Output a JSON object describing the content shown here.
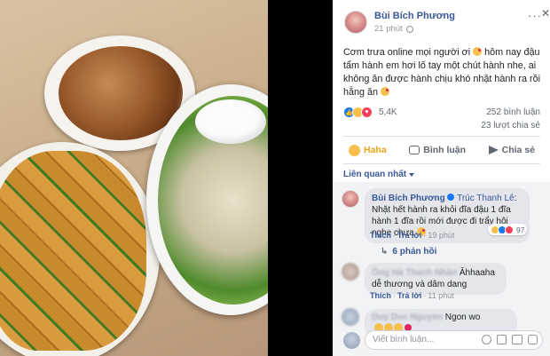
{
  "post": {
    "author": "Bùi Bích Phương",
    "time": "21 phút",
    "text_part1": "Cơm trưa online mọi người ơi",
    "text_part2": "hôm nay đậu tẩm hành em hơi lố tay một chút hành nhe, ai không ăn được hành chịu khó nhặt hành ra rồi hẵng ăn",
    "reaction_count": "5,4K",
    "comment_count": "252 bình luận",
    "share_count": "23 lượt chia sẻ",
    "more_symbol": "···",
    "close_symbol": "✕"
  },
  "actions": {
    "haha_label": "Haha",
    "comment_label": "Bình luận",
    "share_label": "Chia sẻ"
  },
  "related_label": "Liên quan nhất",
  "comments": [
    {
      "name": "Bùi Bích Phương",
      "mention": "Trúc Thanh Lê",
      "text": ": Nhặt hết hành ra khỏi đĩa đậu 1 đĩa hành 1 đĩa rồi mới được đi trẩy hội nghe chưa",
      "like_label": "Thích",
      "reply_label": "Trả lời",
      "time": "19 phút",
      "reaction_count": "97"
    },
    {
      "name": "Ông Hà Thanh Nhàn",
      "text": "Ăhhaaha dễ thương và dâm dang",
      "like_label": "Thích",
      "reply_label": "Trả lời",
      "time": "11 phút"
    },
    {
      "name": "Duy Duc Nguyen",
      "text": "Ngon wo"
    }
  ],
  "replies_label": "6 phản hồi",
  "reply_arrow": "↳",
  "write_placeholder": "Viết bình luận...",
  "colors": {
    "link": "#385898",
    "haha_active": "#e6a516",
    "like_blue": "#1877f2",
    "love_red": "#f33e58"
  },
  "icons": [
    "globe-icon",
    "more-icon",
    "close-icon",
    "like-icon",
    "haha-icon",
    "love-icon",
    "comment-icon",
    "share-icon",
    "verified-icon",
    "emoji-icon",
    "camera-icon",
    "gif-icon",
    "sticker-icon"
  ]
}
